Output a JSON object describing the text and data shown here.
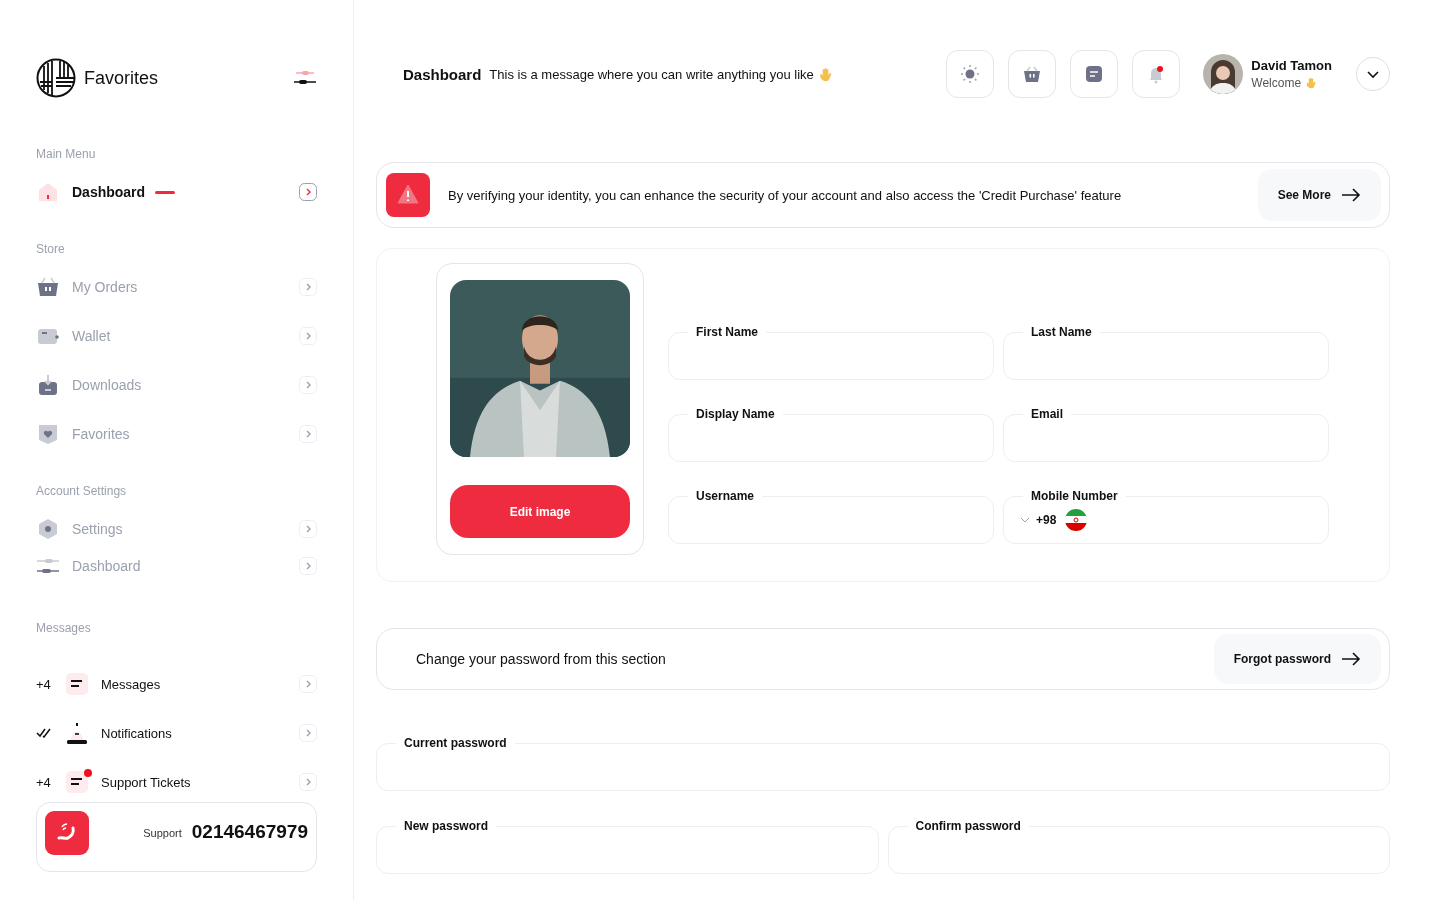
{
  "sidebar": {
    "brand": "Favorites",
    "sections": [
      {
        "title": "Main Menu",
        "items": [
          {
            "label": "Dashboard",
            "selected": true
          }
        ]
      },
      {
        "title": "Store",
        "items": [
          {
            "label": "My Orders",
            "selected": false
          },
          {
            "label": "Wallet",
            "selected": false
          },
          {
            "label": "Downloads",
            "selected": false
          },
          {
            "label": "Favorites",
            "selected": false
          }
        ]
      },
      {
        "title": "Account Settings",
        "items": [
          {
            "label": "Settings",
            "selected": false
          },
          {
            "label": "Dashboard",
            "selected": false
          }
        ]
      }
    ],
    "messages": {
      "title": "Messages",
      "items": [
        {
          "kind": "count",
          "count": "+4",
          "label": "Messages",
          "dot": false
        },
        {
          "kind": "read",
          "label": "Notifications",
          "dot": false
        },
        {
          "kind": "count",
          "count": "+4",
          "label": "Support Tickets",
          "dot": true
        }
      ]
    },
    "support": {
      "label": "Support",
      "phone": "02146467979"
    }
  },
  "header": {
    "title": "Dashboard",
    "message": "This is a message where you can write anything you like",
    "tools": [
      {
        "dot": false
      },
      {
        "dot": false
      },
      {
        "dot": false
      },
      {
        "dot": true
      }
    ],
    "user": {
      "name": "David Tamon",
      "greeting": "Welcome"
    }
  },
  "alert": {
    "text": "By verifying your identity, you can enhance the security of your account and also access the 'Credit Purchase' feature",
    "button": "See More"
  },
  "profile": {
    "button": "Edit image",
    "fields": [
      {
        "label": "First Name",
        "kind": "text"
      },
      {
        "label": "Last Name",
        "kind": "text"
      },
      {
        "label": "Display Name",
        "kind": "text"
      },
      {
        "label": "Email",
        "kind": "text"
      },
      {
        "label": "Username",
        "kind": "text"
      },
      {
        "label": "Mobile Number",
        "kind": "phone",
        "code": "+98"
      }
    ]
  },
  "password": {
    "text": "Change your password from this section",
    "button": "Forgot password",
    "fields": [
      {
        "label": "Current password",
        "wide": true
      },
      {
        "label": "New password",
        "wide": false
      },
      {
        "label": "Confirm password",
        "wide": false
      }
    ]
  }
}
